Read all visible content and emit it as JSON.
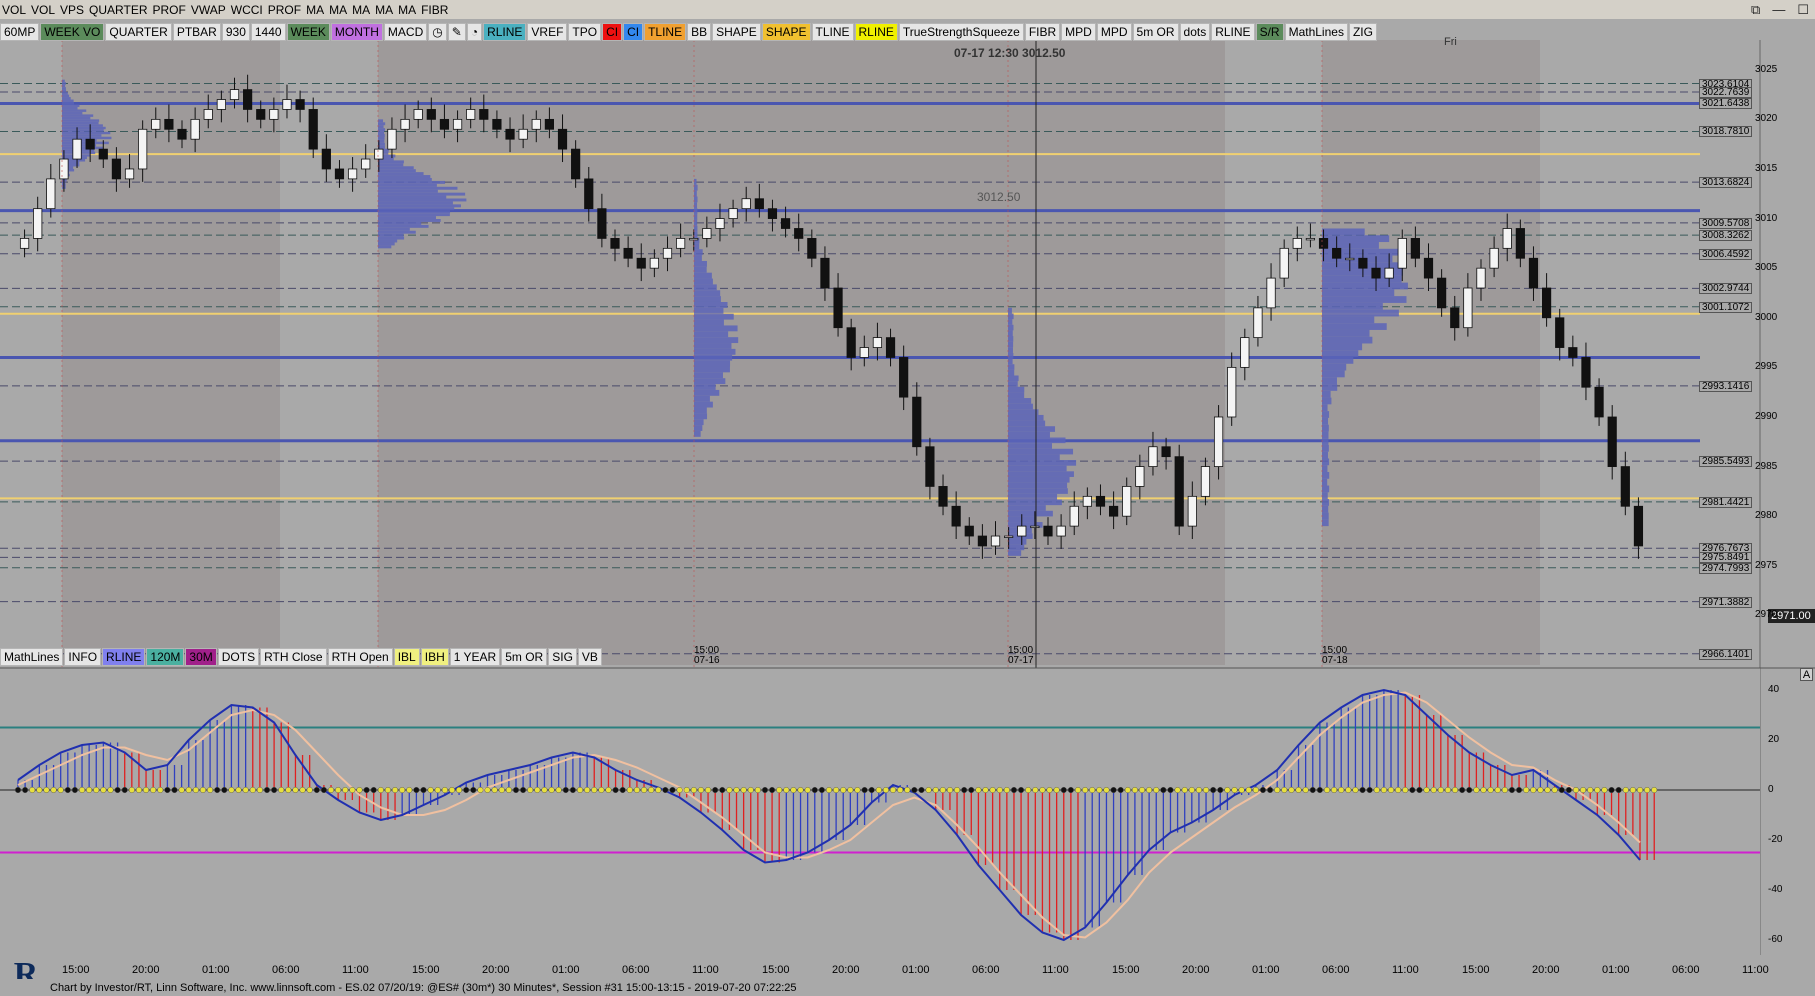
{
  "toolbar_top": [
    "VOL",
    "VOL",
    "VPS",
    "QUARTER",
    "PROF",
    "VWAP",
    "WCCI",
    "PROF",
    "MA",
    "MA",
    "MA",
    "MA",
    "MA",
    "FIBR"
  ],
  "window_controls": {
    "restore": "⧉",
    "minimize": "—",
    "maximize": "☐"
  },
  "toolbar_main": [
    {
      "label": "60MP",
      "bg": "#e6e6e6"
    },
    {
      "label": "WEEK VO",
      "bg": "#5b8b5b"
    },
    {
      "label": "QUARTER",
      "bg": "#e6e6e6"
    },
    {
      "label": "PTBAR",
      "bg": "#e6e6e6"
    },
    {
      "label": "930",
      "bg": "#e6e6e6"
    },
    {
      "label": "1440",
      "bg": "#e6e6e6"
    },
    {
      "label": "WEEK",
      "bg": "#5b8b5b"
    },
    {
      "label": "MONTH",
      "bg": "#c070e0"
    },
    {
      "label": "MACD",
      "bg": "#e6e6e6"
    },
    {
      "label": "◷",
      "bg": "#e6e6e6"
    },
    {
      "label": "✎",
      "bg": "#e6e6e6"
    },
    {
      "label": "◔",
      "bg": "#e6e6e6"
    },
    {
      "label": "RLINE",
      "bg": "#4ab0c0"
    },
    {
      "label": "VREF",
      "bg": "#e6e6e6"
    },
    {
      "label": "TPO",
      "bg": "#e6e6e6"
    },
    {
      "label": "CI",
      "bg": "#ee1111"
    },
    {
      "label": "CI",
      "bg": "#3388ee"
    },
    {
      "label": "TLINE",
      "bg": "#f0a030"
    },
    {
      "label": "BB",
      "bg": "#e6e6e6"
    },
    {
      "label": "SHAPE",
      "bg": "#e6e6e6"
    },
    {
      "label": "SHAPE",
      "bg": "#f0c030"
    },
    {
      "label": "TLINE",
      "bg": "#e6e6e6"
    },
    {
      "label": "RLINE",
      "bg": "#f0f000"
    },
    {
      "label": "TrueStrengthSqueeze",
      "bg": "#e6e6e6"
    },
    {
      "label": "FIBR",
      "bg": "#e6e6e6"
    },
    {
      "label": "MPD",
      "bg": "#e6e6e6"
    },
    {
      "label": "MPD",
      "bg": "#e6e6e6"
    },
    {
      "label": "5m OR",
      "bg": "#e6e6e6"
    },
    {
      "label": "dots",
      "bg": "#e6e6e6"
    },
    {
      "label": "RLINE",
      "bg": "#e6e6e6"
    },
    {
      "label": "S/R",
      "bg": "#5b8b5b"
    },
    {
      "label": "MathLines",
      "bg": "#e6e6e6"
    },
    {
      "label": "ZIG",
      "bg": "#e6e6e6"
    }
  ],
  "toolbar_bottom": [
    {
      "label": "MathLines",
      "bg": "#e6e6e6"
    },
    {
      "label": "INFO",
      "bg": "#e6e6e6"
    },
    {
      "label": "RLINE",
      "bg": "#8080ee"
    },
    {
      "label": "120M",
      "bg": "#4ab0a0"
    },
    {
      "label": "30M",
      "bg": "#a0208a"
    },
    {
      "label": "DOTS",
      "bg": "#e6e6e6"
    },
    {
      "label": "RTH Close",
      "bg": "#e6e6e6"
    },
    {
      "label": "RTH Open",
      "bg": "#e6e6e6"
    },
    {
      "label": "IBL",
      "bg": "#f0f080"
    },
    {
      "label": "IBH",
      "bg": "#f0f080"
    },
    {
      "label": "1 YEAR",
      "bg": "#e6e6e6"
    },
    {
      "label": "5m OR",
      "bg": "#e6e6e6"
    },
    {
      "label": "SIG",
      "bg": "#e6e6e6"
    },
    {
      "label": "VB",
      "bg": "#e6e6e6"
    }
  ],
  "crosshair_readout": "07-17 12:30 3012.50",
  "crosshair_price_label": "3012.50",
  "day_label": "Fri",
  "current_price": "2971.00",
  "panel_tag": "A",
  "price_labels": [
    "3023.6104",
    "3022.7639",
    "3021.6438",
    "3018.7810",
    "3013.6824",
    "3009.5708",
    "3008.3262",
    "3006.4592",
    "3002.9744",
    "3001.1072",
    "2993.1416",
    "2985.5493",
    "2981.4421",
    "2976.7673",
    "2975.8491",
    "2974.7993",
    "2971.3882",
    "2966.1401"
  ],
  "price_axis": [
    "3025",
    "3020",
    "3015",
    "3010",
    "3005",
    "3000",
    "2995",
    "2990",
    "2985",
    "2980",
    "2975",
    "2970"
  ],
  "macd_axis": [
    "40",
    "20",
    "0",
    "-20",
    "-40",
    "-60"
  ],
  "time_axis": [
    "15:00",
    "20:00",
    "01:00",
    "06:00",
    "11:00",
    "15:00",
    "20:00",
    "01:00",
    "06:00",
    "11:00",
    "15:00",
    "20:00",
    "01:00",
    "06:00",
    "11:00",
    "15:00",
    "20:00",
    "01:00",
    "06:00",
    "11:00",
    "15:00",
    "20:00",
    "01:00",
    "06:00",
    "11:00"
  ],
  "session_labels": [
    {
      "time": "15:00",
      "date": "07-16"
    },
    {
      "time": "15:00",
      "date": "07-17"
    },
    {
      "time": "15:00",
      "date": "07-18"
    }
  ],
  "status": "Chart by Investor/RT, Linn Software, Inc. www.linnsoft.com - ES.02   07/20/19: @ES# (30m*) 30 Minutes*, Session #31 15:00-13:15 - 2019-07-20 07:22:25",
  "logo_letter": "R",
  "chart_data": {
    "type": "candlestick",
    "timeframe": "30 Minutes",
    "symbol": "@ES#",
    "ylim": [
      2965,
      3028
    ],
    "closes": [
      3008,
      3011,
      3014,
      3016,
      3018,
      3017,
      3016,
      3014,
      3015,
      3019,
      3020,
      3019,
      3018,
      3020,
      3021,
      3022,
      3023,
      3021,
      3020,
      3021,
      3022,
      3021,
      3017,
      3015,
      3014,
      3015,
      3016,
      3017,
      3019,
      3020,
      3021,
      3020,
      3019,
      3020,
      3021,
      3020,
      3019,
      3018,
      3019,
      3020,
      3019,
      3017,
      3014,
      3011,
      3008,
      3007,
      3006,
      3005,
      3006,
      3007,
      3008,
      3008,
      3009,
      3010,
      3011,
      3012,
      3011,
      3010,
      3009,
      3008,
      3006,
      3003,
      2999,
      2996,
      2997,
      2998,
      2996,
      2992,
      2987,
      2983,
      2981,
      2979,
      2978,
      2977,
      2978,
      2978,
      2979,
      2979,
      2978,
      2979,
      2981,
      2982,
      2981,
      2980,
      2983,
      2985,
      2987,
      2986,
      2979,
      2982,
      2985,
      2990,
      2995,
      2998,
      3001,
      3004,
      3007,
      3008,
      3008,
      3007,
      3006,
      3006,
      3005,
      3004,
      3005,
      3008,
      3006,
      3004,
      3001,
      2999,
      3003,
      3005,
      3007,
      3009,
      3006,
      3003,
      3000,
      2997,
      2996,
      2993,
      2990,
      2985,
      2981,
      2977
    ],
    "series": [
      {
        "name": "MACD",
        "values": [
          4,
          10,
          15,
          18,
          19,
          15,
          8,
          10,
          20,
          28,
          34,
          33,
          27,
          14,
          2,
          -4,
          -9,
          -12,
          -10,
          -6,
          -2,
          3,
          6,
          8,
          10,
          13,
          15,
          13,
          8,
          4,
          1,
          -3,
          -9,
          -16,
          -24,
          -29,
          -28,
          -25,
          -20,
          -14,
          -5,
          2,
          -1,
          -8,
          -18,
          -30,
          -40,
          -50,
          -57,
          -60,
          -55,
          -45,
          -34,
          -24,
          -17,
          -13,
          -8,
          -2,
          2,
          8,
          18,
          27,
          33,
          38,
          40,
          38,
          30,
          22,
          15,
          10,
          6,
          8,
          2,
          -4,
          -10,
          -18,
          -28
        ]
      },
      {
        "name": "Signal",
        "values": [
          2,
          6,
          10,
          14,
          17,
          17,
          14,
          12,
          16,
          23,
          30,
          32,
          30,
          24,
          15,
          6,
          -2,
          -7,
          -10,
          -10,
          -8,
          -4,
          1,
          4,
          7,
          10,
          13,
          14,
          12,
          9,
          5,
          1,
          -5,
          -11,
          -18,
          -25,
          -27,
          -27,
          -24,
          -20,
          -13,
          -6,
          -3,
          -6,
          -14,
          -23,
          -33,
          -42,
          -51,
          -58,
          -59,
          -53,
          -44,
          -33,
          -25,
          -19,
          -13,
          -7,
          -2,
          4,
          13,
          22,
          29,
          35,
          38,
          39,
          35,
          28,
          21,
          15,
          10,
          9,
          4,
          0,
          -6,
          -13,
          -21
        ]
      },
      {
        "name": "Histogram",
        "values": [
          2,
          4,
          5,
          4,
          2,
          -2,
          -6,
          -2,
          4,
          5,
          4,
          1,
          -3,
          -10,
          -13,
          -10,
          -7,
          -5,
          0,
          4,
          6,
          7,
          5,
          4,
          3,
          3,
          2,
          -1,
          -4,
          -5,
          -4,
          -4,
          -4,
          -5,
          -6,
          -4,
          -1,
          2,
          4,
          6,
          8,
          8,
          2,
          -2,
          -4,
          -7,
          -7,
          -8,
          -6,
          -2,
          4,
          8,
          10,
          9,
          8,
          6,
          5,
          5,
          4,
          4,
          5,
          5,
          4,
          3,
          2,
          -1,
          -5,
          -6,
          -6,
          -5,
          -4,
          -1,
          -2,
          -4,
          -4,
          -5,
          -7
        ]
      }
    ],
    "macd_reference_levels": [
      25,
      0,
      -25
    ]
  }
}
